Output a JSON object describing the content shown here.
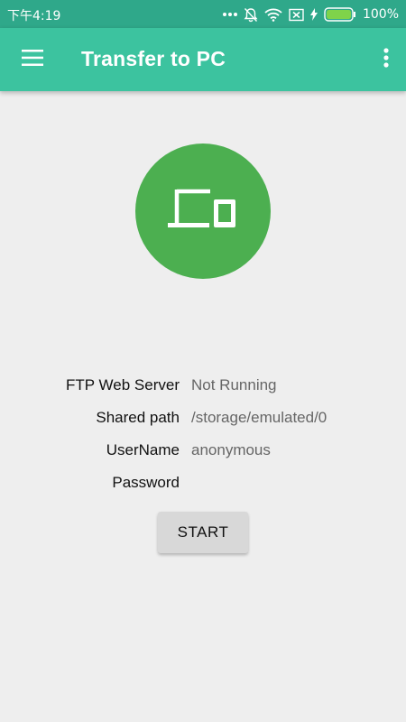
{
  "status_bar": {
    "time": "下午4:19",
    "battery_percent": "100%",
    "battery_level": 1.0,
    "icons": [
      "more-dots-icon",
      "silent-bell-icon",
      "wifi-icon",
      "no-sim-icon",
      "charging-icon",
      "battery-icon"
    ]
  },
  "app_bar": {
    "title": "Transfer to PC",
    "menu_icon": "hamburger-menu-icon",
    "overflow_icon": "more-vert-icon"
  },
  "hero": {
    "icon": "devices-icon"
  },
  "info": [
    {
      "label": "FTP Web Server",
      "value": "Not Running"
    },
    {
      "label": "Shared path",
      "value": "/storage/emulated/0"
    },
    {
      "label": "UserName",
      "value": "anonymous"
    },
    {
      "label": "Password",
      "value": ""
    }
  ],
  "start_button": {
    "label": "START"
  },
  "colors": {
    "status_bar": "#2fa88a",
    "app_bar": "#3cc39f",
    "hero": "#4caf50",
    "background": "#eeeeee",
    "button": "#d8d8d8"
  }
}
